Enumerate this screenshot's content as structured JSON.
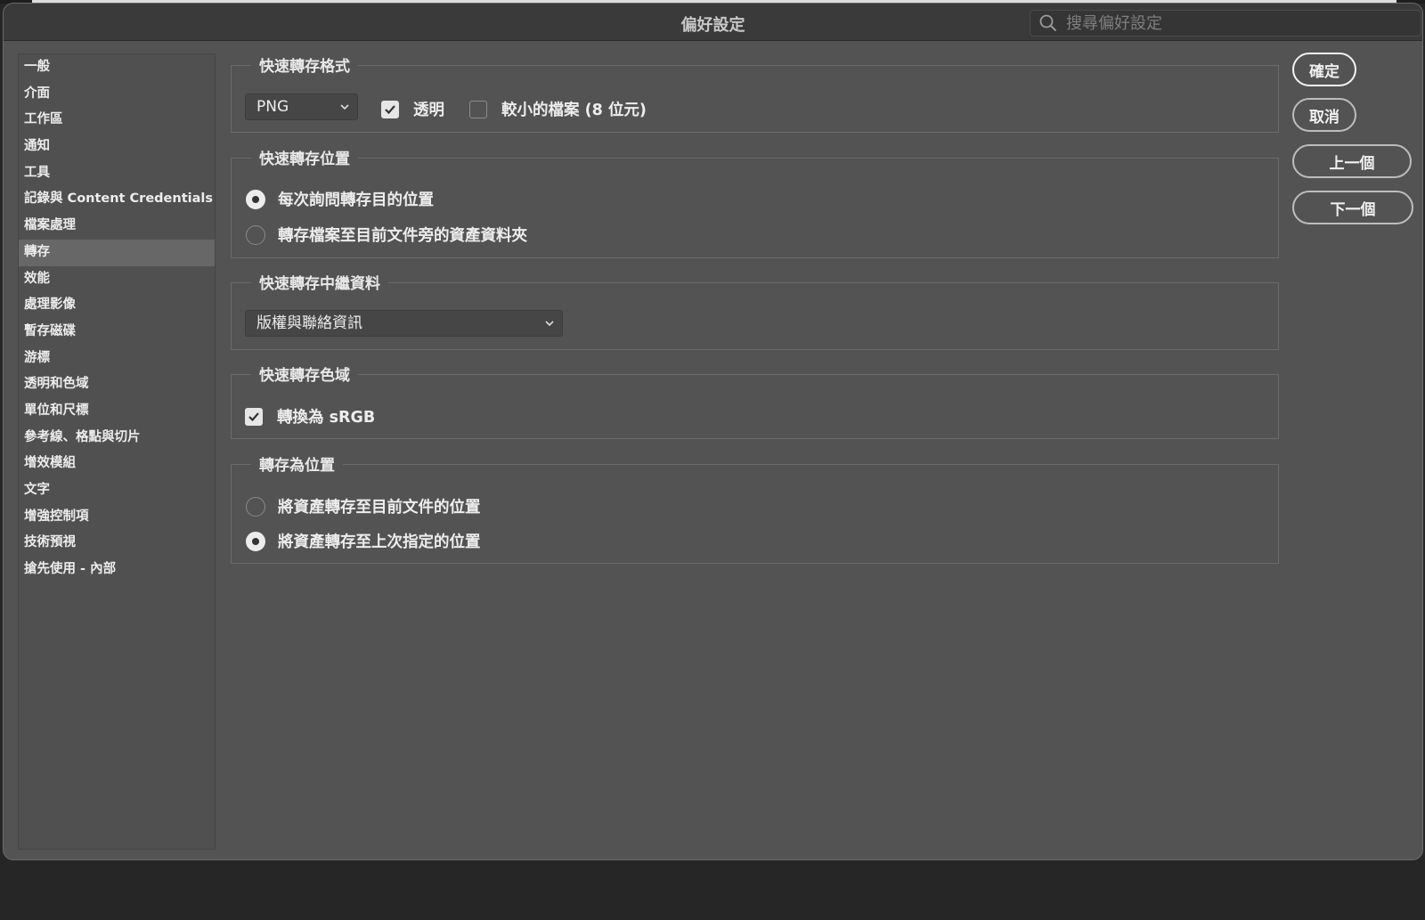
{
  "window": {
    "title": "偏好設定"
  },
  "search": {
    "placeholder": "搜尋偏好設定"
  },
  "sidebar": {
    "items": [
      "一般",
      "介面",
      "工作區",
      "通知",
      "工具",
      "記錄與 Content Credentials",
      "檔案處理",
      "轉存",
      "效能",
      "處理影像",
      "暫存磁碟",
      "游標",
      "透明和色域",
      "單位和尺標",
      "參考線、格點與切片",
      "增效模組",
      "文字",
      "增強控制項",
      "技術預視",
      "搶先使用 - 內部"
    ],
    "selected": "轉存"
  },
  "format_group": {
    "title": "快速轉存格式",
    "format_value": "PNG",
    "transparent_label": "透明",
    "transparent_checked": true,
    "smaller_label": "較小的檔案 (8 位元)",
    "smaller_checked": false
  },
  "location_group": {
    "title": "快速轉存位置",
    "option1": "每次詢問轉存目的位置",
    "option2": "轉存檔案至目前文件旁的資產資料夾",
    "selected": 1
  },
  "metadata_group": {
    "title": "快速轉存中繼資料",
    "value": "版權與聯絡資訊"
  },
  "colorspace_group": {
    "title": "快速轉存色域",
    "srgb_label": "轉換為 sRGB",
    "srgb_checked": true
  },
  "export_as_group": {
    "title": "轉存為位置",
    "option1": "將資產轉存至目前文件的位置",
    "option2": "將資產轉存至上次指定的位置",
    "selected": 2
  },
  "buttons": {
    "ok": "確定",
    "cancel": "取消",
    "prev": "上一個",
    "next": "下一個"
  },
  "colors": {
    "panel": "#535353",
    "titlebar": "#3a3a3a",
    "selected_row": "#676767"
  }
}
